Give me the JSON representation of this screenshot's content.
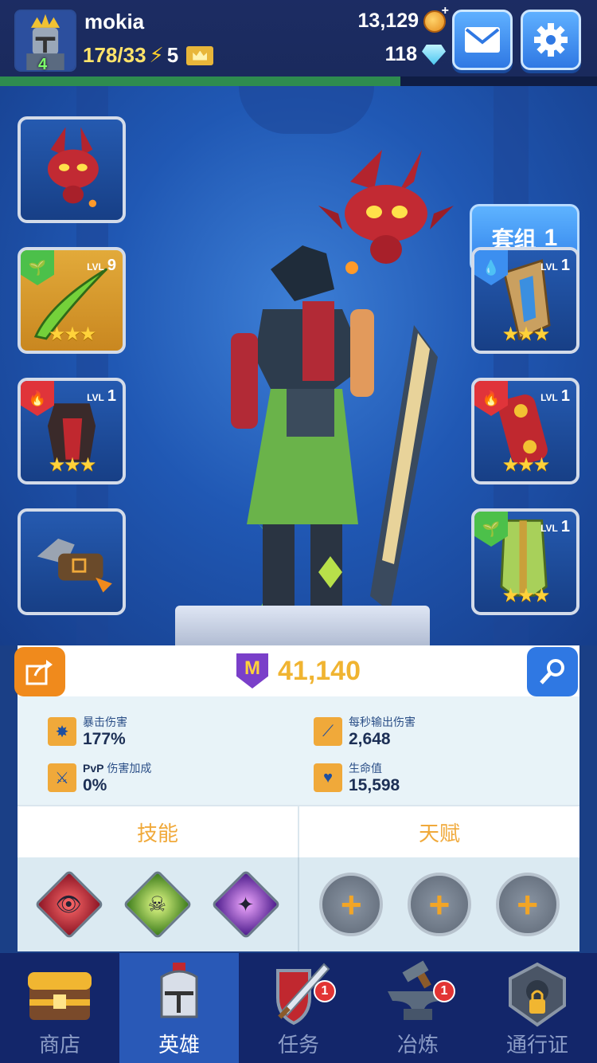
{
  "player": {
    "name": "mokia",
    "level": "4",
    "energy": "178/33",
    "energy_extra": "5"
  },
  "currency": {
    "gold": "13,129",
    "gems": "118"
  },
  "xp_progress": 0.67,
  "set_button": {
    "label": "套组",
    "number": "1"
  },
  "equipment": {
    "weapon": {
      "level_label": "LVL",
      "level": "9",
      "element": "nature",
      "stars": 3
    },
    "armor": {
      "level_label": "LVL",
      "level": "1",
      "element": "fire",
      "stars": 3
    },
    "shield": {
      "level_label": "LVL",
      "level": "1",
      "element": "water",
      "stars": 3
    },
    "gloves": {
      "level_label": "LVL",
      "level": "1",
      "element": "fire",
      "stars": 3
    },
    "boots": {
      "level_label": "LVL",
      "level": "1",
      "element": "nature",
      "stars": 3
    }
  },
  "stats": {
    "power": "41,140",
    "power_badge": "M",
    "crit_label": "暴击伤害",
    "crit_value": "177%",
    "dps_label": "每秒输出伤害",
    "dps_value": "2,648",
    "pvp_label_prefix": "PvP",
    "pvp_label": "伤害加成",
    "pvp_value": "0%",
    "hp_label": "生命值",
    "hp_value": "15,598"
  },
  "tabs": {
    "skills": "技能",
    "talents": "天赋"
  },
  "talent_add_symbol": "+",
  "nav": {
    "shop": "商店",
    "hero": "英雄",
    "quests": "任务",
    "quests_badge": "1",
    "forge": "冶炼",
    "forge_badge": "1",
    "pass": "通行证"
  },
  "colors": {
    "accent_gold": "#f0b431",
    "brand_blue": "#2f78e3",
    "background_blue": "#1a3f86"
  }
}
